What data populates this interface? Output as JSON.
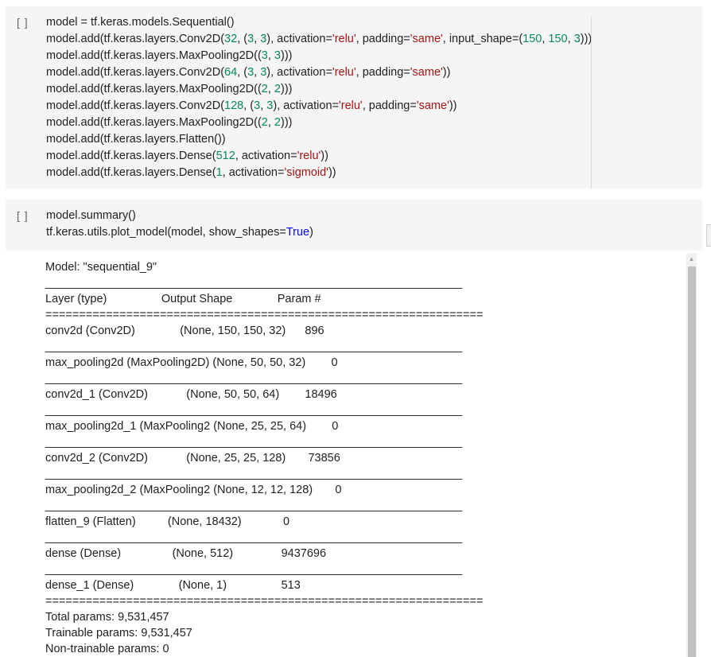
{
  "cell1": {
    "run_label": "[ ]",
    "lines": [
      [
        {
          "t": "model = tf.keras.models.Sequential()",
          "c": ""
        }
      ],
      [
        {
          "t": "model.add(tf.keras.layers.Conv2D(",
          "c": ""
        },
        {
          "t": "32",
          "c": "num"
        },
        {
          "t": ", (",
          "c": ""
        },
        {
          "t": "3",
          "c": "num"
        },
        {
          "t": ", ",
          "c": ""
        },
        {
          "t": "3",
          "c": "num"
        },
        {
          "t": "), activation=",
          "c": ""
        },
        {
          "t": "'relu'",
          "c": "str"
        },
        {
          "t": ", padding=",
          "c": ""
        },
        {
          "t": "'same'",
          "c": "str"
        },
        {
          "t": ", input_shape=(",
          "c": ""
        },
        {
          "t": "150",
          "c": "num"
        },
        {
          "t": ", ",
          "c": ""
        },
        {
          "t": "150",
          "c": "num"
        },
        {
          "t": ", ",
          "c": ""
        },
        {
          "t": "3",
          "c": "num"
        },
        {
          "t": ")))",
          "c": ""
        }
      ],
      [
        {
          "t": "model.add(tf.keras.layers.MaxPooling2D((",
          "c": ""
        },
        {
          "t": "3",
          "c": "num"
        },
        {
          "t": ", ",
          "c": ""
        },
        {
          "t": "3",
          "c": "num"
        },
        {
          "t": ")))",
          "c": ""
        }
      ],
      [
        {
          "t": "model.add(tf.keras.layers.Conv2D(",
          "c": ""
        },
        {
          "t": "64",
          "c": "num"
        },
        {
          "t": ", (",
          "c": ""
        },
        {
          "t": "3",
          "c": "num"
        },
        {
          "t": ", ",
          "c": ""
        },
        {
          "t": "3",
          "c": "num"
        },
        {
          "t": "), activation=",
          "c": ""
        },
        {
          "t": "'relu'",
          "c": "str"
        },
        {
          "t": ", padding=",
          "c": ""
        },
        {
          "t": "'same'",
          "c": "str"
        },
        {
          "t": "))",
          "c": ""
        }
      ],
      [
        {
          "t": "model.add(tf.keras.layers.MaxPooling2D((",
          "c": ""
        },
        {
          "t": "2",
          "c": "num"
        },
        {
          "t": ", ",
          "c": ""
        },
        {
          "t": "2",
          "c": "num"
        },
        {
          "t": ")))",
          "c": ""
        }
      ],
      [
        {
          "t": "model.add(tf.keras.layers.Conv2D(",
          "c": ""
        },
        {
          "t": "128",
          "c": "num"
        },
        {
          "t": ", (",
          "c": ""
        },
        {
          "t": "3",
          "c": "num"
        },
        {
          "t": ", ",
          "c": ""
        },
        {
          "t": "3",
          "c": "num"
        },
        {
          "t": "), activation=",
          "c": ""
        },
        {
          "t": "'relu'",
          "c": "str"
        },
        {
          "t": ", padding=",
          "c": ""
        },
        {
          "t": "'same'",
          "c": "str"
        },
        {
          "t": "))",
          "c": ""
        }
      ],
      [
        {
          "t": "model.add(tf.keras.layers.MaxPooling2D((",
          "c": ""
        },
        {
          "t": "2",
          "c": "num"
        },
        {
          "t": ", ",
          "c": ""
        },
        {
          "t": "2",
          "c": "num"
        },
        {
          "t": ")))",
          "c": ""
        }
      ],
      [
        {
          "t": "model.add(tf.keras.layers.Flatten())",
          "c": ""
        }
      ],
      [
        {
          "t": "model.add(tf.keras.layers.Dense(",
          "c": ""
        },
        {
          "t": "512",
          "c": "num"
        },
        {
          "t": ", activation=",
          "c": ""
        },
        {
          "t": "'relu'",
          "c": "str"
        },
        {
          "t": "))",
          "c": ""
        }
      ],
      [
        {
          "t": "model.add(tf.keras.layers.Dense(",
          "c": ""
        },
        {
          "t": "1",
          "c": "num"
        },
        {
          "t": ", activation=",
          "c": ""
        },
        {
          "t": "'sigmoid'",
          "c": "str"
        },
        {
          "t": "))",
          "c": ""
        }
      ]
    ]
  },
  "cell2": {
    "run_label": "[ ]",
    "lines": [
      [
        {
          "t": "model.summary()",
          "c": ""
        }
      ],
      [
        {
          "t": "tf.keras.utils.plot_model(model, show_shapes=",
          "c": ""
        },
        {
          "t": "True",
          "c": "kw"
        },
        {
          "t": ")",
          "c": ""
        }
      ]
    ]
  },
  "output": {
    "lines": [
      "Model: \"sequential_9\"",
      "_________________________________________________________________",
      "Layer (type)                 Output Shape              Param #   ",
      "=================================================================",
      "conv2d (Conv2D)              (None, 150, 150, 32)      896       ",
      "_________________________________________________________________",
      "max_pooling2d (MaxPooling2D) (None, 50, 50, 32)        0         ",
      "_________________________________________________________________",
      "conv2d_1 (Conv2D)            (None, 50, 50, 64)        18496     ",
      "_________________________________________________________________",
      "max_pooling2d_1 (MaxPooling2 (None, 25, 25, 64)        0         ",
      "_________________________________________________________________",
      "conv2d_2 (Conv2D)            (None, 25, 25, 128)       73856     ",
      "_________________________________________________________________",
      "max_pooling2d_2 (MaxPooling2 (None, 12, 12, 128)       0         ",
      "_________________________________________________________________",
      "flatten_9 (Flatten)          (None, 18432)             0         ",
      "_________________________________________________________________",
      "dense (Dense)                (None, 512)               9437696   ",
      "_________________________________________________________________",
      "dense_1 (Dense)              (None, 1)                 513       ",
      "=================================================================",
      "Total params: 9,531,457",
      "Trainable params: 9,531,457",
      "Non-trainable params: 0"
    ]
  },
  "scrollbar": {
    "up_arrow_icon": "triangle-up-icon",
    "up_glyph": "▲"
  }
}
